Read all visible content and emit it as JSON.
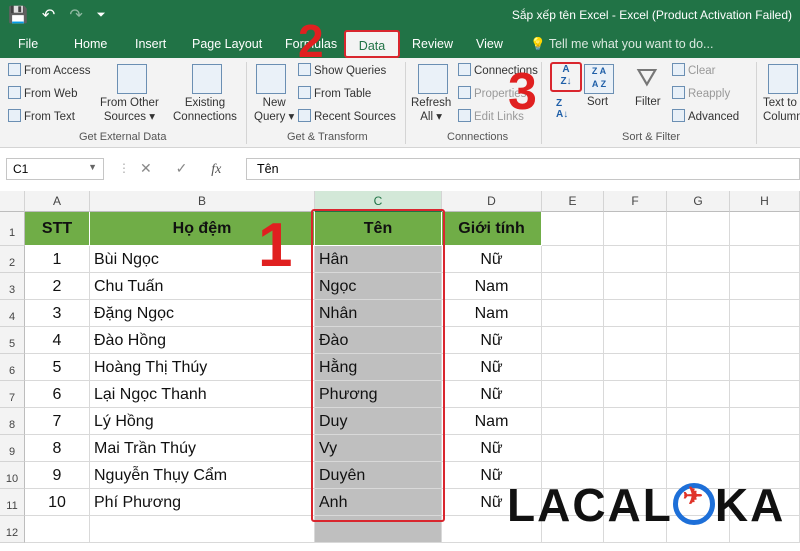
{
  "window": {
    "title": "Sắp xếp tên Excel - Excel (Product Activation Failed)"
  },
  "qat": {
    "save_icon": "save-icon",
    "undo_icon": "undo-icon",
    "redo_icon": "redo-icon",
    "customize_icon": "customize-icon"
  },
  "tabs": [
    "File",
    "Home",
    "Insert",
    "Page Layout",
    "Formulas",
    "Data",
    "Review",
    "View"
  ],
  "tell_me": "Tell me what you want to do...",
  "ribbon": {
    "get_external": {
      "from_access": "From Access",
      "from_web": "From Web",
      "from_text": "From Text",
      "from_other_1": "From Other",
      "from_other_2": "Sources",
      "existing_1": "Existing",
      "existing_2": "Connections",
      "label": "Get External Data"
    },
    "get_transform": {
      "new_query_1": "New",
      "new_query_2": "Query",
      "show_queries": "Show Queries",
      "from_table": "From Table",
      "recent_sources": "Recent Sources",
      "label": "Get & Transform"
    },
    "connections": {
      "refresh_1": "Refresh",
      "refresh_2": "All",
      "connections": "Connections",
      "properties": "Properties",
      "edit_links": "Edit Links",
      "label": "Connections"
    },
    "sort_filter": {
      "sort": "Sort",
      "filter": "Filter",
      "clear": "Clear",
      "reapply": "Reapply",
      "advanced": "Advanced",
      "label": "Sort & Filter"
    },
    "data_tools": {
      "text_to_1": "Text to",
      "text_to_2": "Columns"
    }
  },
  "formula_bar": {
    "name_box": "C1",
    "cancel": "✕",
    "enter": "✓",
    "fx": "fx",
    "content": "Tên"
  },
  "columns": [
    "A",
    "B",
    "C",
    "D",
    "E",
    "F",
    "G",
    "H"
  ],
  "rows": [
    "1",
    "2",
    "3",
    "4",
    "5",
    "6",
    "7",
    "8",
    "9",
    "10",
    "11",
    "12"
  ],
  "table": {
    "headers": [
      "STT",
      "Họ đệm",
      "Tên",
      "Giới tính"
    ],
    "rows": [
      [
        "1",
        "Bùi Ngọc",
        "Hân",
        "Nữ"
      ],
      [
        "2",
        "Chu Tuấn",
        "Ngọc",
        "Nam"
      ],
      [
        "3",
        "Đặng Ngọc",
        "Nhân",
        "Nam"
      ],
      [
        "4",
        "Đào Hồng",
        "Đào",
        "Nữ"
      ],
      [
        "5",
        "Hoàng Thị Thúy",
        "Hằng",
        "Nữ"
      ],
      [
        "6",
        "Lại Ngọc Thanh",
        "Phương",
        "Nữ"
      ],
      [
        "7",
        "Lý Hồng",
        "Duy",
        "Nam"
      ],
      [
        "8",
        "Mai Trần Thúy",
        "Vy",
        "Nữ"
      ],
      [
        "9",
        "Nguyễn Thụy Cẩm",
        "Duyên",
        "Nữ"
      ],
      [
        "10",
        "Phí Phương",
        "Anh",
        "Nữ"
      ]
    ]
  },
  "annotations": {
    "step1": "1",
    "step2": "2",
    "step3": "3"
  },
  "logo": {
    "text_1": "LACAL",
    "text_2": "KA"
  },
  "colors": {
    "excel_green": "#217346",
    "header_green": "#70ad47",
    "selection_grey": "#bfbfbf",
    "annotation_red": "#e02020"
  }
}
